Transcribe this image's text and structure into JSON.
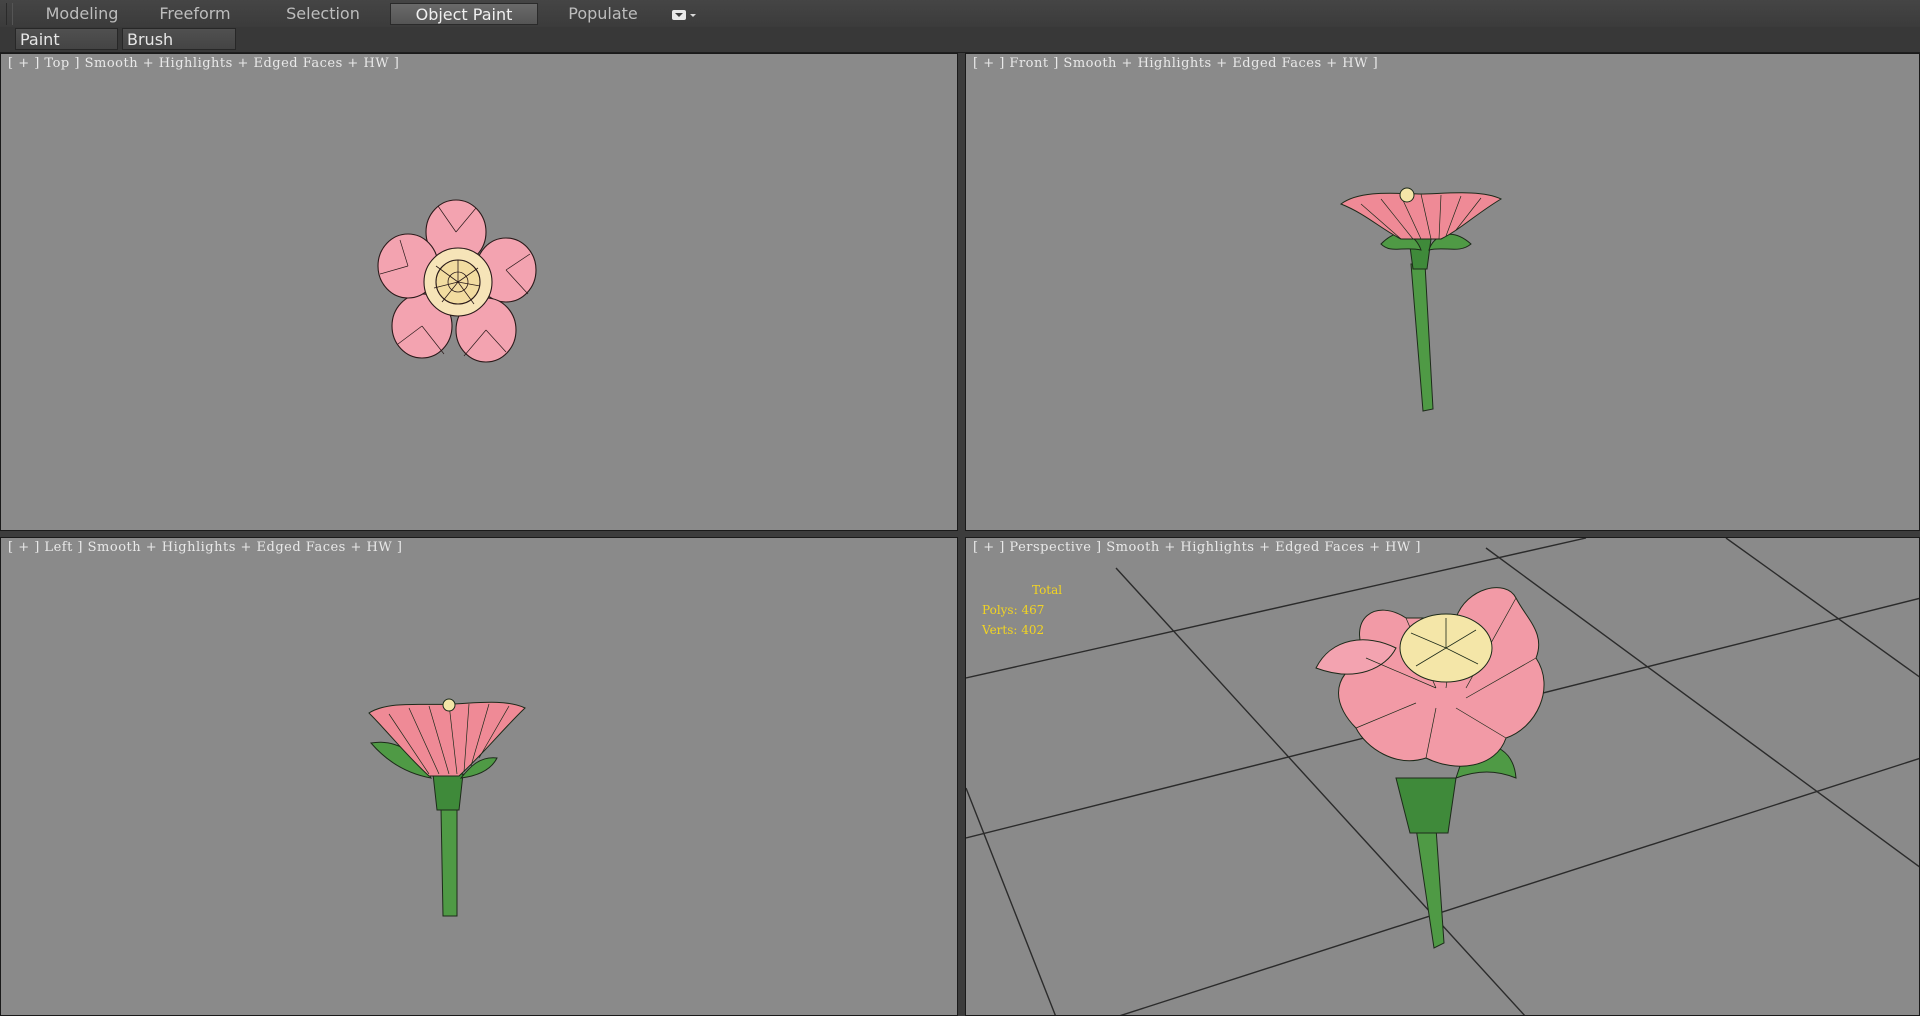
{
  "ribbon": {
    "tabs": [
      {
        "label": "Modeling",
        "active": false
      },
      {
        "label": "Freeform",
        "active": false
      },
      {
        "label": "Selection",
        "active": false
      },
      {
        "label": "Object Paint",
        "active": true
      },
      {
        "label": "Populate",
        "active": false
      }
    ],
    "extra_icon": "toggle-ribbon-icon"
  },
  "sub_toolbar": {
    "paint_objects": "Paint Objects",
    "brush_settings": "Brush Settings"
  },
  "viewports": {
    "top": {
      "label": "[ + ] Top ] Smooth + Highlights + Edged Faces + HW ]"
    },
    "front": {
      "label": "[ + ] Front ] Smooth + Highlights + Edged Faces + HW ]"
    },
    "left": {
      "label": "[ + ] Left ] Smooth + Highlights + Edged Faces + HW ]"
    },
    "perspective": {
      "label": "[ + ] Perspective ] Smooth + Highlights + Edged Faces + HW ]"
    }
  },
  "stats": {
    "total": "Total",
    "polys": "Polys: 467",
    "verts": "Verts: 402"
  },
  "colors": {
    "petal": "#f29aa6",
    "petal_dark": "#e35d6e",
    "center": "#f4e6a8",
    "stem": "#4f9a45",
    "viewport_bg": "#8a8a8a",
    "stats_text": "#f2d422"
  }
}
